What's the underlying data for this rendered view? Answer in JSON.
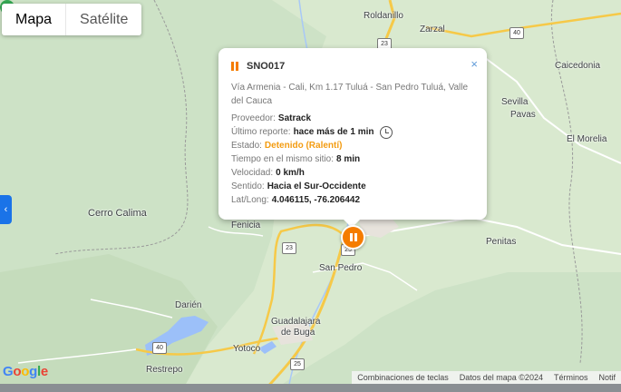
{
  "map_type": {
    "map_label": "Mapa",
    "satellite_label": "Satélite"
  },
  "places": {
    "roldanillo": "Roldanillo",
    "zarzal": "Zarzal",
    "caicedonia": "Caicedonia",
    "sevilla": "Sevilla",
    "pavas": "Pavas",
    "el_morelia": "El Morelia",
    "cerro_calima": "Cerro Calima",
    "fenicia": "Fenicia",
    "penitas": "Penitas",
    "san_pedro": "San Pedro",
    "darien": "Darién",
    "guadalajara": "Guadalajara",
    "de_buga": "de Buga",
    "yotoco": "Yotoco",
    "restrepo": "Restrepo"
  },
  "route_shields": {
    "r23a": "23",
    "r40a": "40",
    "r23b": "23",
    "r25a": "25",
    "r40b": "40",
    "r25b": "25"
  },
  "popup": {
    "vehicle_id": "SNO017",
    "address": "Vía Armenia - Cali, Km 1.17 Tuluá - San Pedro Tuluá, Valle del Cauca",
    "provider_label": "Proveedor:",
    "provider_value": "Satrack",
    "last_report_label": "Último reporte:",
    "last_report_value": "hace más de 1 min",
    "state_label": "Estado:",
    "state_value": "Detenido (Ralentí)",
    "time_label": "Tiempo en el mismo sitio:",
    "time_value": "8 min",
    "speed_label": "Velocidad:",
    "speed_value": "0 km/h",
    "direction_label": "Sentido:",
    "direction_value": "Hacia el Sur-Occidente",
    "latlong_label": "Lat/Long:",
    "latlong_value": "4.046115, -76.206442",
    "close_glyph": "×"
  },
  "footer": {
    "shortcuts": "Combinaciones de teclas",
    "map_data": "Datos del mapa ©2024",
    "terms": "Términos",
    "report": "Notif"
  },
  "colors": {
    "accent": "#f57c00",
    "state_warning": "#f39c12",
    "toggle_blue": "#1a73e8"
  }
}
